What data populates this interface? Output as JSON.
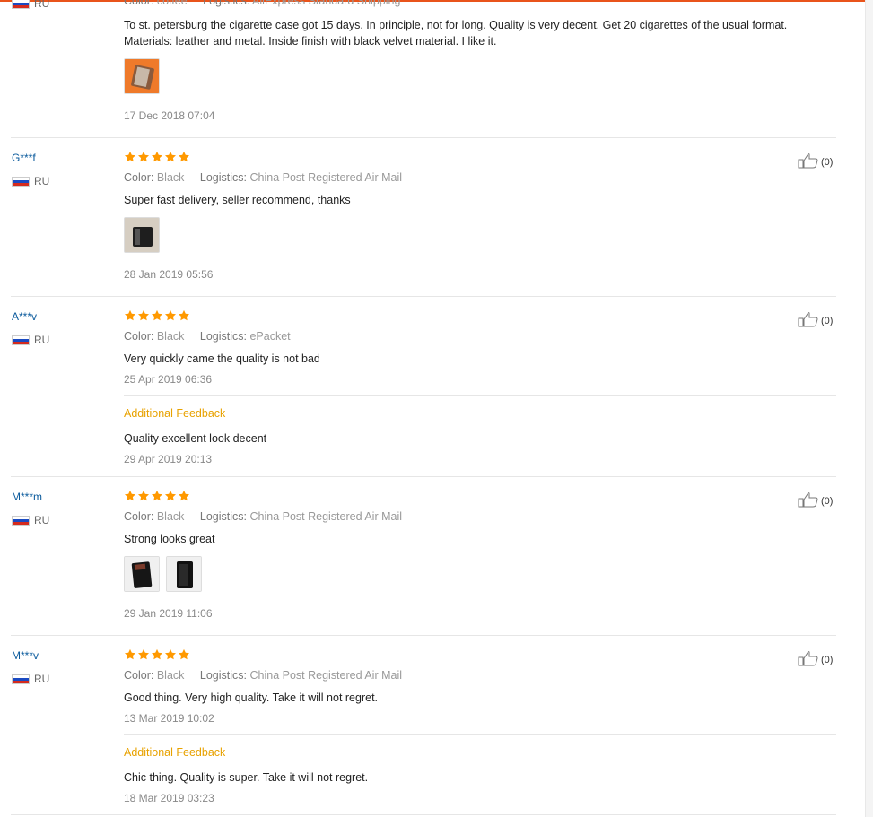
{
  "colors": {
    "accent": "#e9541b",
    "star": "#ff9900",
    "username": "#0a5a9c",
    "feedback_label": "#e8a200"
  },
  "labels": {
    "color": "Color:",
    "logistics": "Logistics:",
    "additional_feedback": "Additional Feedback"
  },
  "reviews": [
    {
      "country": "RU",
      "color": "coffee",
      "logistics": "AliExpress Standard Shipping",
      "text": "To st. petersburg the cigarette case got 15 days. In principle, not for long. Quality is very decent. Get 20 cigarettes of the usual format. Materials: leather and metal. Inside finish with black velvet material. I like it.",
      "date": "17 Dec 2018 07:04"
    },
    {
      "user": "G***f",
      "country": "RU",
      "stars": 5,
      "color": "Black",
      "logistics": "China Post Registered Air Mail",
      "text": "Super fast delivery, seller recommend, thanks",
      "date": "28 Jan 2019 05:56",
      "likes": "(0)"
    },
    {
      "user": "A***v",
      "country": "RU",
      "stars": 5,
      "color": "Black",
      "logistics": "ePacket",
      "text": "Very quickly came the quality is not bad",
      "date": "25 Apr 2019 06:36",
      "likes": "(0)",
      "additional": {
        "text": "Quality excellent look decent",
        "date": "29 Apr 2019 20:13"
      }
    },
    {
      "user": "M***m",
      "country": "RU",
      "stars": 5,
      "color": "Black",
      "logistics": "China Post Registered Air Mail",
      "text": "Strong looks great",
      "date": "29 Jan 2019 11:06",
      "likes": "(0)"
    },
    {
      "user": "M***v",
      "country": "RU",
      "stars": 5,
      "color": "Black",
      "logistics": "China Post Registered Air Mail",
      "text": "Good thing. Very high quality. Take it will not regret.",
      "date": "13 Mar 2019 10:02",
      "likes": "(0)",
      "additional": {
        "text": "Chic thing. Quality is super. Take it will not regret.",
        "date": "18 Mar 2019 03:23"
      }
    }
  ]
}
